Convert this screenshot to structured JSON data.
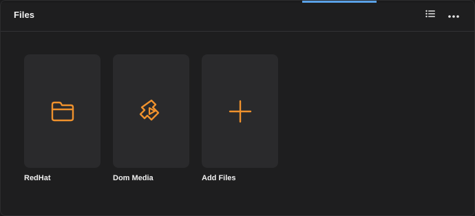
{
  "window": {
    "title": "Files"
  },
  "header": {
    "list_view_icon": "list-icon",
    "more_icon": "ellipsis-icon"
  },
  "items": [
    {
      "label": "RedHat",
      "icon": "folder-icon"
    },
    {
      "label": "Dom Media",
      "icon": "media-icon"
    },
    {
      "label": "Add Files",
      "icon": "plus-icon"
    }
  ],
  "colors": {
    "accent": "#f0922d",
    "background": "#1e1e1f",
    "tile": "#2a2a2c",
    "text": "#f0f0f0",
    "top_strip_highlight": "#5aa2e8"
  }
}
